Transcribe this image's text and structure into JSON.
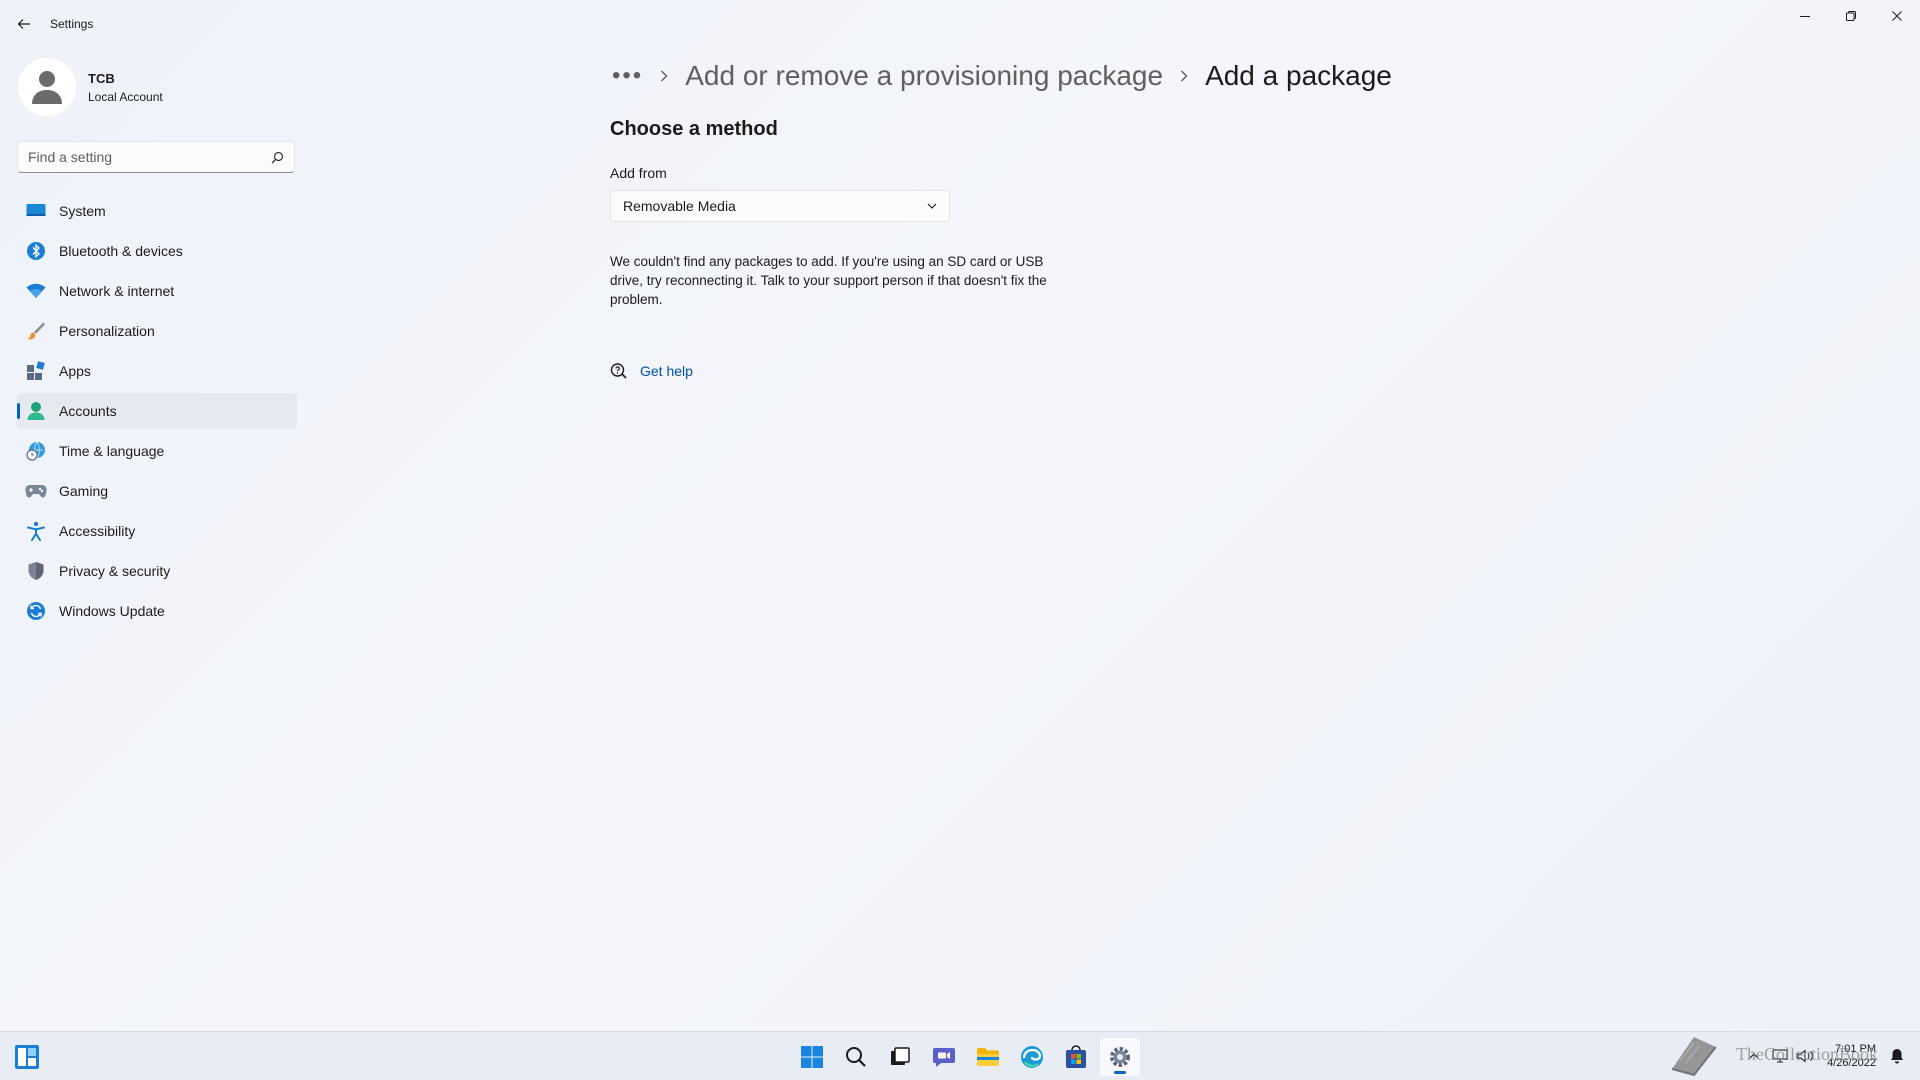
{
  "window": {
    "title": "Settings"
  },
  "profile": {
    "name": "TCB",
    "account_type": "Local Account"
  },
  "search": {
    "placeholder": "Find a setting",
    "value": ""
  },
  "sidebar": {
    "items": [
      {
        "label": "System",
        "icon": "system-icon",
        "active": false
      },
      {
        "label": "Bluetooth & devices",
        "icon": "bluetooth-icon",
        "active": false
      },
      {
        "label": "Network & internet",
        "icon": "wifi-icon",
        "active": false
      },
      {
        "label": "Personalization",
        "icon": "brush-icon",
        "active": false
      },
      {
        "label": "Apps",
        "icon": "apps-icon",
        "active": false
      },
      {
        "label": "Accounts",
        "icon": "accounts-icon",
        "active": true
      },
      {
        "label": "Time & language",
        "icon": "globe-clock-icon",
        "active": false
      },
      {
        "label": "Gaming",
        "icon": "gamepad-icon",
        "active": false
      },
      {
        "label": "Accessibility",
        "icon": "accessibility-icon",
        "active": false
      },
      {
        "label": "Privacy & security",
        "icon": "shield-icon",
        "active": false
      },
      {
        "label": "Windows Update",
        "icon": "update-icon",
        "active": false
      }
    ]
  },
  "breadcrumb": {
    "more": "•••",
    "parent": "Add or remove a provisioning package",
    "current": "Add a package"
  },
  "main": {
    "section_title": "Choose a method",
    "field_label": "Add from",
    "dropdown_value": "Removable Media",
    "message": "We couldn't find any packages to add. If you're using an SD card or USB drive, try reconnecting it. Talk to your support person if that doesn't fix the problem.",
    "help_link": "Get help"
  },
  "taskbar": {
    "apps": [
      "start-icon",
      "search-icon",
      "task-view-icon",
      "chat-icon",
      "file-explorer-icon",
      "edge-icon",
      "store-icon",
      "settings-icon"
    ],
    "active_app": "settings-icon",
    "time": "7:01 PM",
    "date": "4/26/2022"
  },
  "watermark": {
    "text": "TheCollectionBook"
  },
  "colors": {
    "accent": "#0067c0",
    "link": "#0050a6",
    "background": "#f2f5fb"
  }
}
